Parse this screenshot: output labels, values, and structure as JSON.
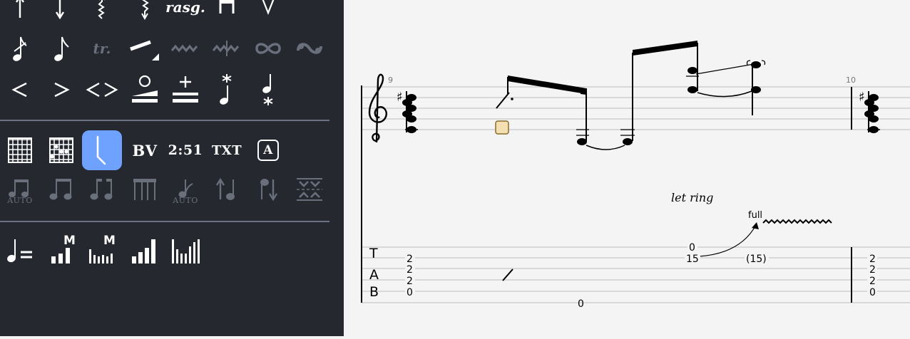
{
  "palette": {
    "row1": {
      "rasgueado_label": "rasg."
    },
    "row2": {
      "trill_label": "tr."
    },
    "row4": {
      "bend_vibrato_label": "BV",
      "time_label": "2:51",
      "text_label": "TXT",
      "annotation_label": "A"
    },
    "row5": {
      "auto_label": "AUTO",
      "auto_label_2": "AUTO"
    },
    "row6": {
      "metronome_badge": "M",
      "metronome_badge_2": "M"
    },
    "colors": {
      "background": "#262830",
      "selected": "#6fa1ff",
      "disabled": "#6a6f7c"
    }
  },
  "score": {
    "measure_9": "9",
    "measure_10": "10",
    "let_ring": "let ring",
    "bend_amount": "full",
    "tab_clef": {
      "t": "T",
      "a": "A",
      "b": "B"
    },
    "tab": {
      "chord1": [
        "2",
        "2",
        "2",
        "0"
      ],
      "bass_0": "0",
      "string1_0": "0",
      "string2_15": "15",
      "string2_15_paren": "(15)",
      "chord10": [
        "2",
        "2",
        "2",
        "0"
      ]
    }
  }
}
